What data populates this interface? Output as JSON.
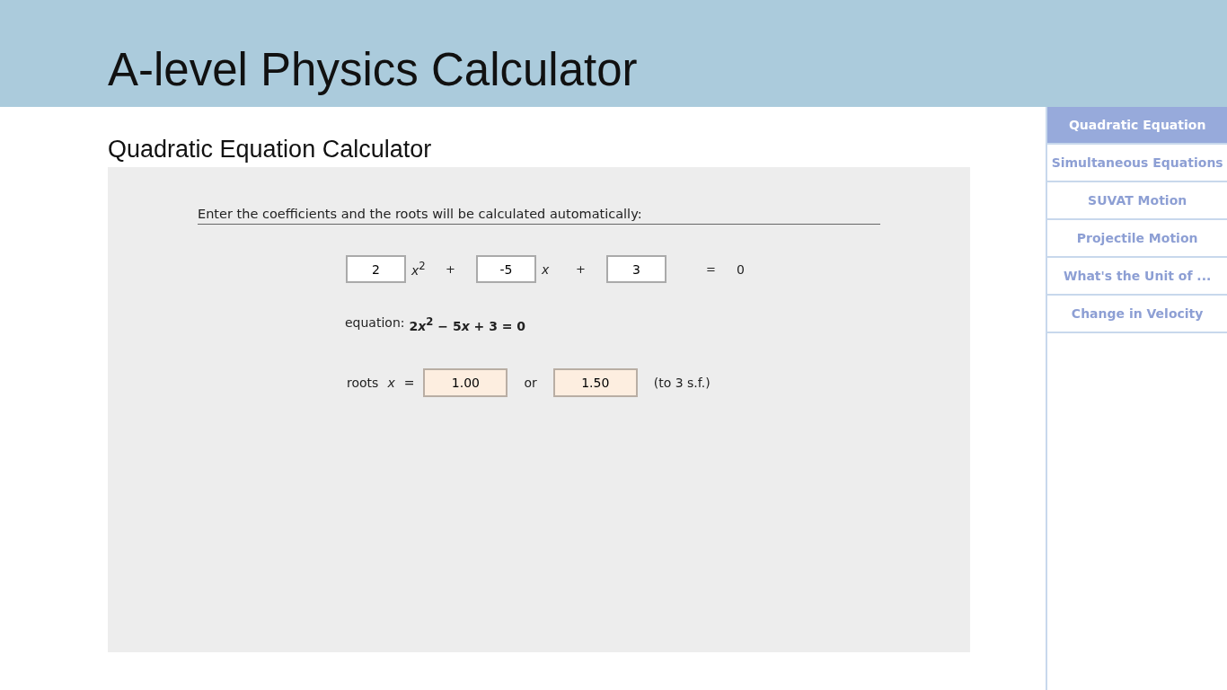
{
  "header": {
    "title": "A-level Physics Calculator"
  },
  "page": {
    "heading": "Quadratic Equation Calculator",
    "instruction": "Enter the coefficients and the roots will be calculated automatically:",
    "terms": [
      {
        "value": "2",
        "label": "*x*$^{2}$",
        "operator": "+"
      },
      {
        "value": "-5",
        "label": "*x*",
        "operator": "+"
      },
      {
        "value": "3",
        "operator": "="
      }
    ],
    "rhs": "0",
    "equation_label": "equation:",
    "equation": [
      "2",
      "*x*$^{2}$",
      " − 5",
      "*x*",
      " + 3 = 0"
    ],
    "roots_label": "roots",
    "roots_var": "x",
    "roots_eq": "=",
    "roots": [
      "1.00",
      "1.50"
    ],
    "or": "or",
    "precision": "(to 3 s.f.)"
  },
  "sidebar": {
    "items": [
      {
        "label": "Quadratic Equation",
        "selected": true
      },
      {
        "label": "Simultaneous Equations",
        "selected": false
      },
      {
        "label": "SUVAT Motion",
        "selected": false
      },
      {
        "label": "Projectile Motion",
        "selected": false
      },
      {
        "label": "What's the Unit of ...",
        "selected": false
      },
      {
        "label": "Change in Velocity",
        "selected": false
      }
    ]
  }
}
